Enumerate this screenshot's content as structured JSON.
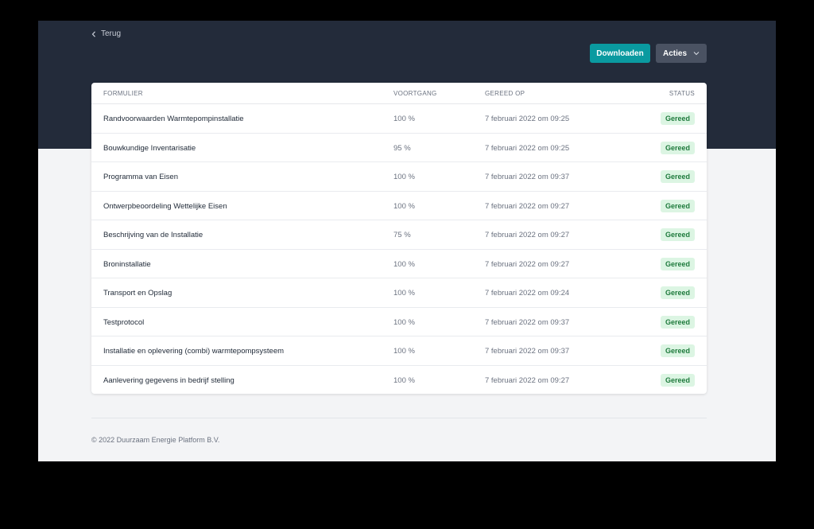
{
  "nav": {
    "back_label": "Terug"
  },
  "toolbar": {
    "download_label": "Downloaden",
    "actions_label": "Acties"
  },
  "table": {
    "headers": {
      "form": "FORMULIER",
      "progress": "VOORTGANG",
      "finished_on": "GEREED OP",
      "status": "STATUS"
    },
    "rows": [
      {
        "name": "Randvoorwaarden Warmtepompinstallatie",
        "progress": "100 %",
        "date": "7 februari 2022 om 09:25",
        "status": "Gereed"
      },
      {
        "name": "Bouwkundige Inventarisatie",
        "progress": "95 %",
        "date": "7 februari 2022 om 09:25",
        "status": "Gereed"
      },
      {
        "name": "Programma van Eisen",
        "progress": "100 %",
        "date": "7 februari 2022 om 09:37",
        "status": "Gereed"
      },
      {
        "name": "Ontwerpbeoordeling Wettelijke Eisen",
        "progress": "100 %",
        "date": "7 februari 2022 om 09:27",
        "status": "Gereed"
      },
      {
        "name": "Beschrijving van de Installatie",
        "progress": "75 %",
        "date": "7 februari 2022 om 09:27",
        "status": "Gereed"
      },
      {
        "name": "Broninstallatie",
        "progress": "100 %",
        "date": "7 februari 2022 om 09:27",
        "status": "Gereed"
      },
      {
        "name": "Transport en Opslag",
        "progress": "100 %",
        "date": "7 februari 2022 om 09:24",
        "status": "Gereed"
      },
      {
        "name": "Testprotocol",
        "progress": "100 %",
        "date": "7 februari 2022 om 09:37",
        "status": "Gereed"
      },
      {
        "name": "Installatie en oplevering (combi) warmtepompsysteem",
        "progress": "100 %",
        "date": "7 februari 2022 om 09:37",
        "status": "Gereed"
      },
      {
        "name": "Aanlevering gegevens in bedrijf stelling",
        "progress": "100 %",
        "date": "7 februari 2022 om 09:27",
        "status": "Gereed"
      }
    ]
  },
  "footer": {
    "copyright": "© 2022 Duurzaam Energie Platform B.V."
  },
  "colors": {
    "header_bg": "#232b3a",
    "accent": "#0a9aa0",
    "status_badge_bg": "#dcf5e3",
    "status_badge_text": "#1e7a3c"
  },
  "icons": {
    "back": "chevron-left-icon",
    "actions_dropdown": "chevron-down-icon"
  }
}
